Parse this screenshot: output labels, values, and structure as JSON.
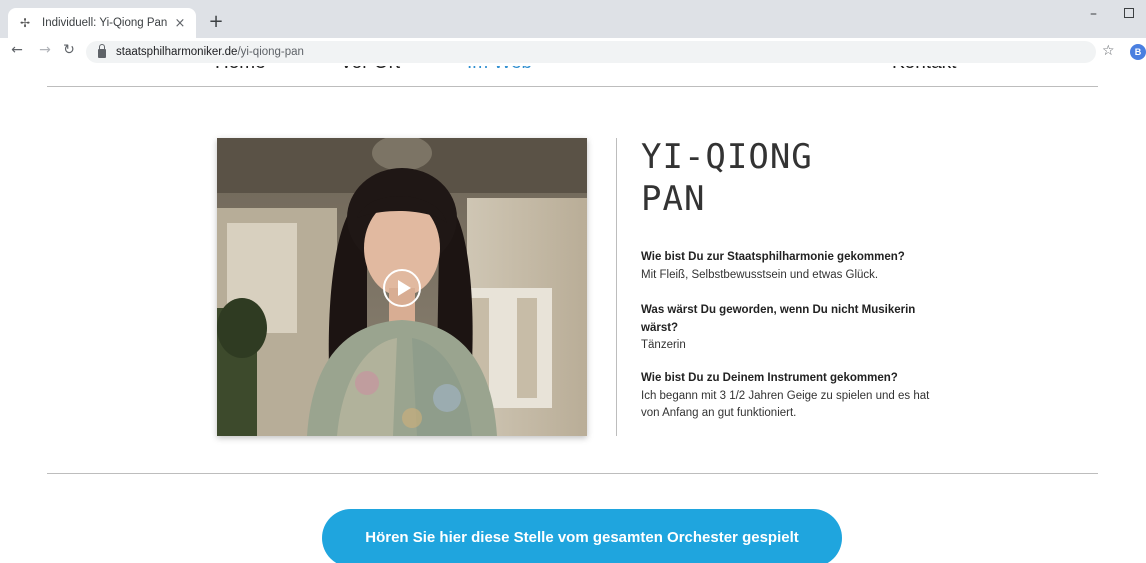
{
  "browser": {
    "tab_title": "Individuell: Yi-Qiong Pan",
    "tab_close": "×",
    "new_tab": "+",
    "url_host": "staatsphilharmoniker.de",
    "url_path": "/yi-qiong-pan",
    "profile_initial": "B"
  },
  "site_nav": {
    "items": [
      {
        "label": "Home"
      },
      {
        "label": "Vor Ort"
      },
      {
        "label": "Im Web"
      },
      {
        "label": "Kontakt"
      }
    ],
    "active_item": "Im Web"
  },
  "profile": {
    "name_line1": "YI-QIONG",
    "name_line2": "PAN",
    "qa": [
      {
        "question": "Wie bist Du zur Staatsphilharmonie gekommen?",
        "answer": "Mit Fleiß, Selbstbewusstsein und etwas Glück."
      },
      {
        "question": "Was wärst Du geworden, wenn Du nicht Musikerin wärst?",
        "answer": "Tänzerin"
      },
      {
        "question": "Wie bist Du zu Deinem Instrument gekommen?",
        "answer": "Ich begann mit 3 1/2 Jahren Geige zu spielen und es hat von Anfang an gut funktioniert."
      }
    ]
  },
  "cta": {
    "label": "Hören Sie hier diese Stelle vom gesamten Orchester gespielt"
  },
  "colors": {
    "accent": "#1fa5de",
    "nav_active": "#2f8fd0"
  }
}
